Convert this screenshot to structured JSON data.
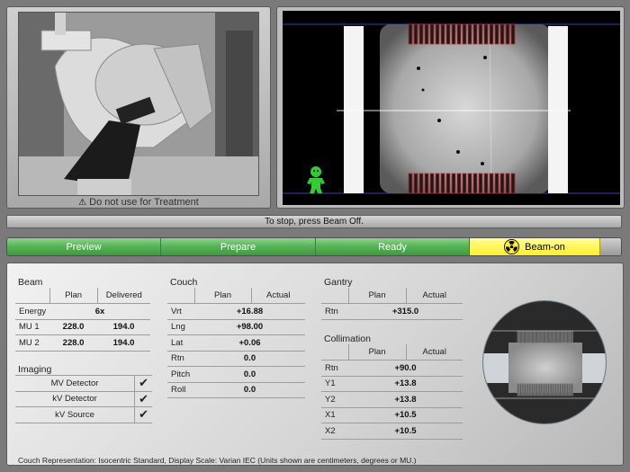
{
  "camera": {
    "warning": "Do not use for Treatment",
    "warning_icon": "warning-triangle-icon"
  },
  "imaging_view": {
    "overlay_icon": "patient-orientation-figure-icon",
    "overlay_color": "#33cc33"
  },
  "status": {
    "message": "To stop, press Beam Off."
  },
  "workflow": {
    "steps": [
      {
        "label": "Preview"
      },
      {
        "label": "Prepare"
      },
      {
        "label": "Ready"
      },
      {
        "label": "Beam-on"
      }
    ],
    "active_step": "Beam-on",
    "colors": {
      "done": "#58b458",
      "active": "#ffee2a"
    }
  },
  "beam": {
    "title": "Beam",
    "col_plan": "Plan",
    "col_delivered": "Delivered",
    "energy_label": "Energy",
    "energy_value": "6x",
    "rows": [
      {
        "label": "MU 1",
        "plan": "228.0",
        "delivered": "194.0"
      },
      {
        "label": "MU 2",
        "plan": "228.0",
        "delivered": "194.0"
      }
    ]
  },
  "imaging": {
    "title": "Imaging",
    "items": [
      {
        "label": "MV Detector",
        "checked": true
      },
      {
        "label": "kV Detector",
        "checked": true
      },
      {
        "label": "kV Source",
        "checked": true
      }
    ],
    "check_glyph": "✔"
  },
  "couch": {
    "title": "Couch",
    "col_plan": "Plan",
    "col_actual": "Actual",
    "rows": [
      {
        "label": "Vrt",
        "value": "+16.88"
      },
      {
        "label": "Lng",
        "value": "+98.00"
      },
      {
        "label": "Lat",
        "value": "+0.06"
      },
      {
        "label": "Rtn",
        "value": "0.0"
      },
      {
        "label": "Pitch",
        "value": "0.0"
      },
      {
        "label": "Roll",
        "value": "0.0"
      }
    ]
  },
  "gantry": {
    "title": "Gantry",
    "col_plan": "Plan",
    "col_actual": "Actual",
    "rows": [
      {
        "label": "Rtn",
        "value": "+315.0"
      }
    ]
  },
  "collimation": {
    "title": "Collimation",
    "col_plan": "Plan",
    "col_actual": "Actual",
    "rows": [
      {
        "label": "Rtn",
        "value": "+90.0"
      },
      {
        "label": "Y1",
        "value": "+13.8"
      },
      {
        "label": "Y2",
        "value": "+13.8"
      },
      {
        "label": "X1",
        "value": "+10.5"
      },
      {
        "label": "X2",
        "value": "+10.5"
      }
    ]
  },
  "footer": {
    "text": "Couch Representation: Isocentric Standard, Display Scale: Varian IEC (Units shown are centimeters, degrees or MU.)"
  }
}
